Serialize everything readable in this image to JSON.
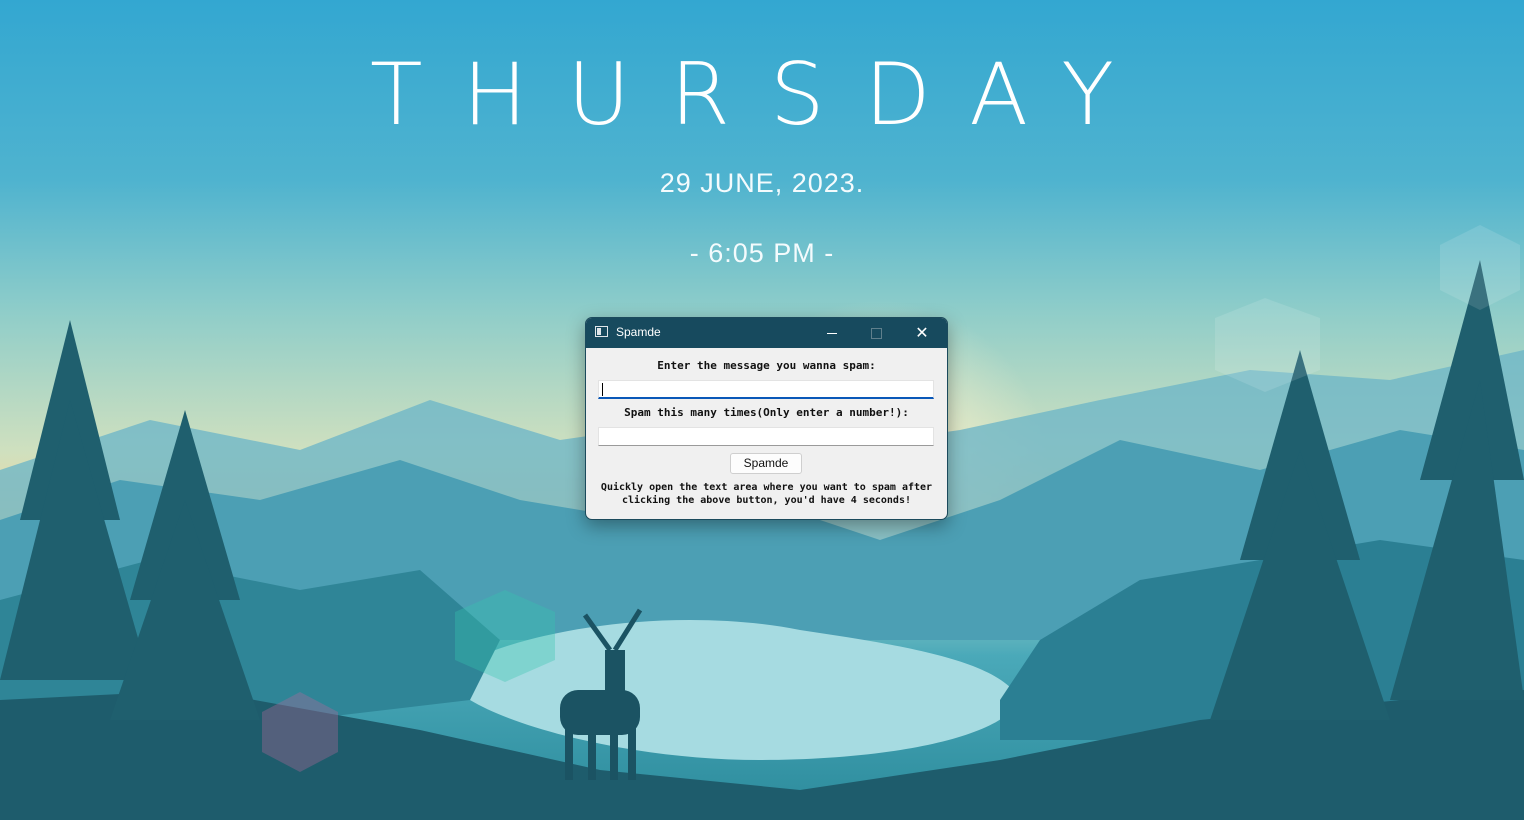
{
  "desktop": {
    "day": "THURSDAY",
    "date": "29 JUNE, 2023.",
    "time": "- 6:05 PM -"
  },
  "window": {
    "title": "Spamde",
    "minimize_icon": "minimize-icon",
    "maximize_icon": "maximize-icon",
    "close_icon": "close-icon",
    "close_glyph": "✕",
    "message_label": "Enter the message you wanna spam:",
    "message_value": "",
    "count_label": "Spam this many times(Only enter a number!):",
    "count_value": "",
    "button_label": "Spamde",
    "note_line1": "Quickly open the text area where you want to spam after",
    "note_line2": "clicking the above button, you'd have 4 seconds!"
  },
  "colors": {
    "titlebar": "#174a5e",
    "focus_accent": "#0a58b8",
    "sky_top": "#33a7d1",
    "sunset": "#f3d89a",
    "forest_dark": "#1f5f6e"
  }
}
